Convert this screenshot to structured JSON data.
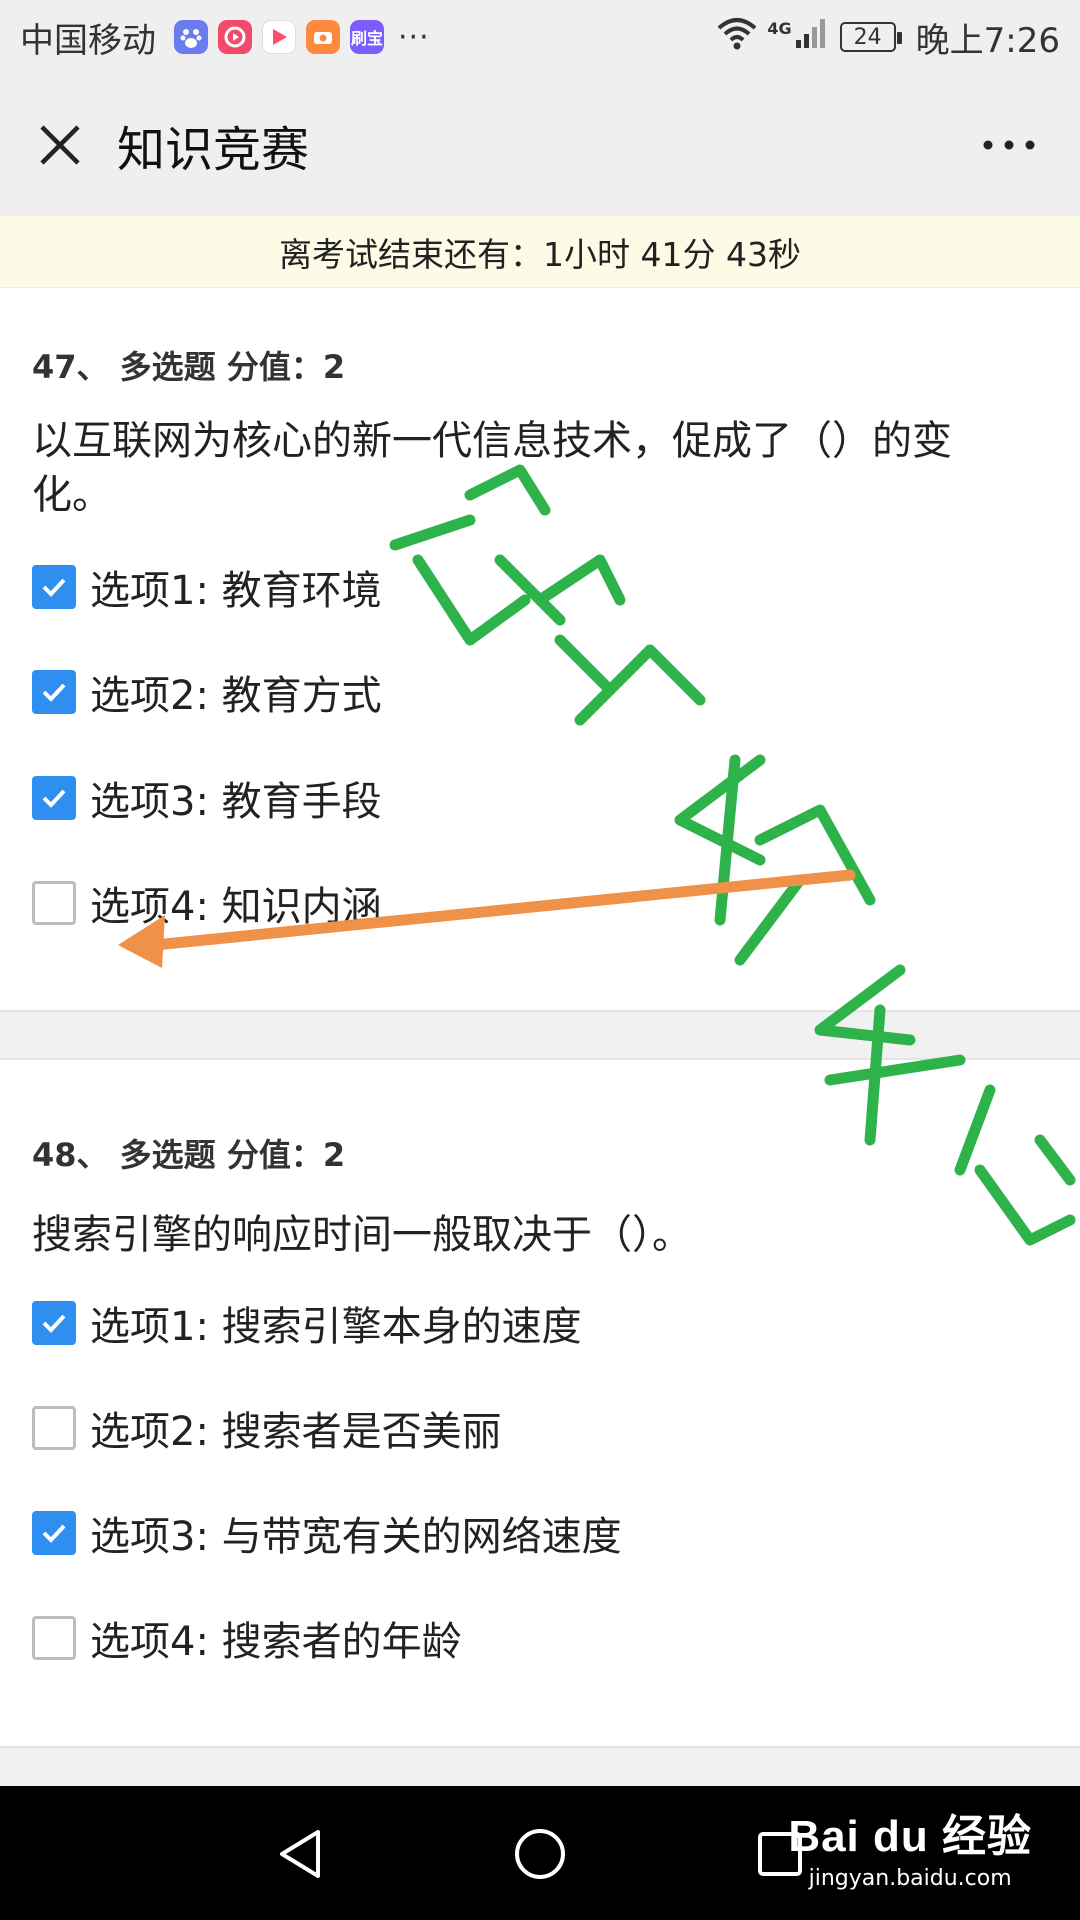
{
  "status_bar": {
    "carrier": "中国移动",
    "apps": [
      {
        "icon": "baidu-paw-icon",
        "color": "#6b7cf0",
        "text": ""
      },
      {
        "icon": "video-app-icon",
        "color": "#f24a6d",
        "text": ""
      },
      {
        "icon": "play-app-icon",
        "color": "#ff4d6a",
        "text": ""
      },
      {
        "icon": "camera-app-icon",
        "color": "#ff8a3d",
        "text": ""
      },
      {
        "icon": "shuabao-app-icon",
        "color": "#7a5cff",
        "text": "刷宝"
      }
    ],
    "more_dots": "···",
    "network": "4G",
    "battery": "24",
    "time": "晚上7:26"
  },
  "title_bar": {
    "title": "知识竞赛",
    "close_icon": "close-icon",
    "more_icon": "more-icon"
  },
  "countdown": {
    "text": "离考试结束还有：1小时 41分 43秒"
  },
  "questions": [
    {
      "header": "47、 多选题 分值：2",
      "text": "以互联网为核心的新一代信息技术，促成了（）的变化。",
      "options": [
        {
          "label": "选项1: 教育环境",
          "checked": true
        },
        {
          "label": "选项2: 教育方式",
          "checked": true
        },
        {
          "label": "选项3: 教育手段",
          "checked": true
        },
        {
          "label": "选项4: 知识内涵",
          "checked": false
        }
      ]
    },
    {
      "header": "48、 多选题 分值：2",
      "text": "搜索引擎的响应时间一般取决于（）。",
      "options": [
        {
          "label": "选项1: 搜索引擎本身的速度",
          "checked": true
        },
        {
          "label": "选项2: 搜索者是否美丽",
          "checked": false
        },
        {
          "label": "选项3: 与带宽有关的网络速度",
          "checked": true
        },
        {
          "label": "选项4: 搜索者的年龄",
          "checked": false
        }
      ]
    }
  ],
  "colors": {
    "checked": "#2f8ff0",
    "annotation_green": "#2db34a",
    "annotation_arrow": "#f0914a"
  },
  "watermark": {
    "logo": "Bai du 经验",
    "url": "jingyan.baidu.com"
  }
}
